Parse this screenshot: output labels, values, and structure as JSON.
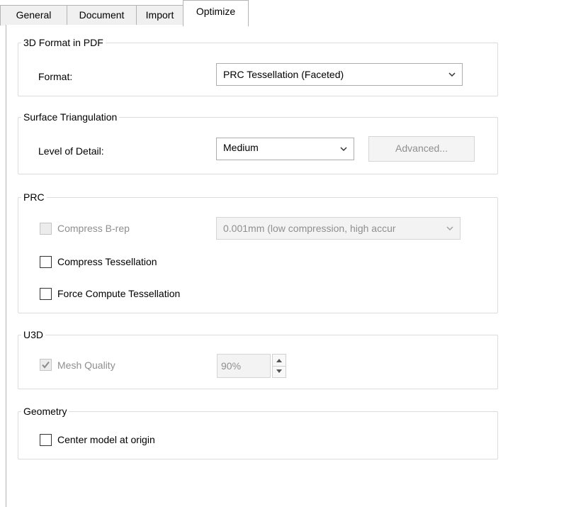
{
  "tabs": [
    {
      "label": "General",
      "active": false
    },
    {
      "label": "Document",
      "active": false
    },
    {
      "label": "Import",
      "active": false
    },
    {
      "label": "Optimize",
      "active": true
    }
  ],
  "format_group": {
    "legend": "3D Format in PDF",
    "format_label": "Format:",
    "format_value": "PRC Tessellation (Faceted)"
  },
  "surface_group": {
    "legend": "Surface Triangulation",
    "detail_label": "Level of Detail:",
    "detail_value": "Medium",
    "advanced_label": "Advanced...",
    "advanced_enabled": false
  },
  "prc_group": {
    "legend": "PRC",
    "compress_brep_label": "Compress B-rep",
    "compress_brep_checked": false,
    "compress_brep_enabled": false,
    "compression_value": "0.001mm (low compression, high accur",
    "compress_tess_label": "Compress Tessellation",
    "compress_tess_checked": false,
    "force_compute_label": "Force Compute Tessellation",
    "force_compute_checked": false
  },
  "u3d_group": {
    "legend": "U3D",
    "mesh_quality_label": "Mesh Quality",
    "mesh_quality_checked": true,
    "mesh_quality_enabled": false,
    "mesh_quality_value": "90%"
  },
  "geometry_group": {
    "legend": "Geometry",
    "center_label": "Center model at origin",
    "center_checked": false
  },
  "colors": {
    "border": "#b4b4b4",
    "group_border": "#dcdcdc",
    "disabled_text": "#8f8f8f"
  }
}
